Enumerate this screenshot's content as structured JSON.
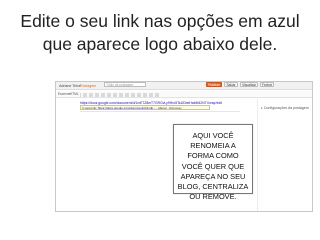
{
  "slide": {
    "title_line1": "Edite o seu link nas opções em azul",
    "title_line2": "que aparece logo abaixo dele."
  },
  "blogger": {
    "user": "Adriane Teixe",
    "page_label": "Postagem",
    "title_placeholder": "Título da postagem",
    "buttons": {
      "publish": "Publicar",
      "save": "Salvar",
      "preview": "Visualizar",
      "close": "Fechar"
    },
    "toolbar": {
      "compose": "Escrever",
      "html": "HTML"
    },
    "editor": {
      "url_text": "https://docs.google.com/document/d/1vrE7Z8mT7GRGvLy9Hro5Ts1lDbeHabM42NTXvnqr/edit",
      "popup_prefix": "Ir para link:",
      "popup_link": "https://docs.google.com/document/d/1vrE...",
      "popup_actions": "· Alterar · Remover"
    },
    "sidebar": {
      "settings_label": "Configurações da postagem"
    }
  },
  "callout": {
    "text": "AQUI VOCÊ RENOMEIA A FORMA COMO VOCÊ QUER QUE APAREÇA NO SEU BLOG, CENTRALIZA OU REMOVE."
  },
  "colors": {
    "accent_orange": "#e0652a",
    "link_blue": "#1a0dab",
    "popup_yellow": "#fffbe0"
  }
}
